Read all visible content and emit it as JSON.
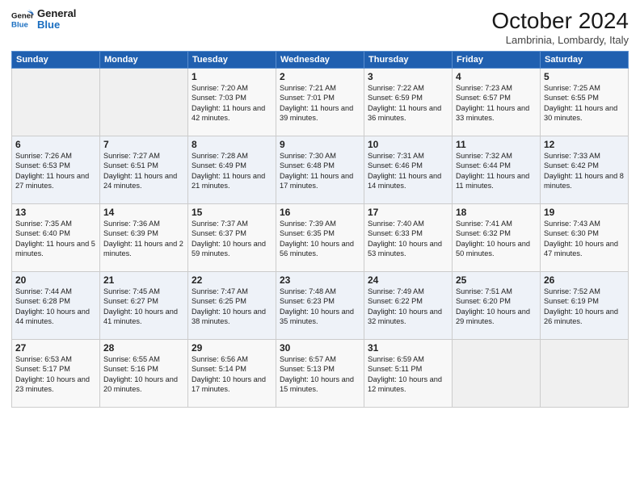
{
  "logo": {
    "line1": "General",
    "line2": "Blue"
  },
  "title": "October 2024",
  "subtitle": "Lambrinia, Lombardy, Italy",
  "days_header": [
    "Sunday",
    "Monday",
    "Tuesday",
    "Wednesday",
    "Thursday",
    "Friday",
    "Saturday"
  ],
  "weeks": [
    [
      {
        "day": "",
        "text": ""
      },
      {
        "day": "",
        "text": ""
      },
      {
        "day": "1",
        "text": "Sunrise: 7:20 AM\nSunset: 7:03 PM\nDaylight: 11 hours and 42 minutes."
      },
      {
        "day": "2",
        "text": "Sunrise: 7:21 AM\nSunset: 7:01 PM\nDaylight: 11 hours and 39 minutes."
      },
      {
        "day": "3",
        "text": "Sunrise: 7:22 AM\nSunset: 6:59 PM\nDaylight: 11 hours and 36 minutes."
      },
      {
        "day": "4",
        "text": "Sunrise: 7:23 AM\nSunset: 6:57 PM\nDaylight: 11 hours and 33 minutes."
      },
      {
        "day": "5",
        "text": "Sunrise: 7:25 AM\nSunset: 6:55 PM\nDaylight: 11 hours and 30 minutes."
      }
    ],
    [
      {
        "day": "6",
        "text": "Sunrise: 7:26 AM\nSunset: 6:53 PM\nDaylight: 11 hours and 27 minutes."
      },
      {
        "day": "7",
        "text": "Sunrise: 7:27 AM\nSunset: 6:51 PM\nDaylight: 11 hours and 24 minutes."
      },
      {
        "day": "8",
        "text": "Sunrise: 7:28 AM\nSunset: 6:49 PM\nDaylight: 11 hours and 21 minutes."
      },
      {
        "day": "9",
        "text": "Sunrise: 7:30 AM\nSunset: 6:48 PM\nDaylight: 11 hours and 17 minutes."
      },
      {
        "day": "10",
        "text": "Sunrise: 7:31 AM\nSunset: 6:46 PM\nDaylight: 11 hours and 14 minutes."
      },
      {
        "day": "11",
        "text": "Sunrise: 7:32 AM\nSunset: 6:44 PM\nDaylight: 11 hours and 11 minutes."
      },
      {
        "day": "12",
        "text": "Sunrise: 7:33 AM\nSunset: 6:42 PM\nDaylight: 11 hours and 8 minutes."
      }
    ],
    [
      {
        "day": "13",
        "text": "Sunrise: 7:35 AM\nSunset: 6:40 PM\nDaylight: 11 hours and 5 minutes."
      },
      {
        "day": "14",
        "text": "Sunrise: 7:36 AM\nSunset: 6:39 PM\nDaylight: 11 hours and 2 minutes."
      },
      {
        "day": "15",
        "text": "Sunrise: 7:37 AM\nSunset: 6:37 PM\nDaylight: 10 hours and 59 minutes."
      },
      {
        "day": "16",
        "text": "Sunrise: 7:39 AM\nSunset: 6:35 PM\nDaylight: 10 hours and 56 minutes."
      },
      {
        "day": "17",
        "text": "Sunrise: 7:40 AM\nSunset: 6:33 PM\nDaylight: 10 hours and 53 minutes."
      },
      {
        "day": "18",
        "text": "Sunrise: 7:41 AM\nSunset: 6:32 PM\nDaylight: 10 hours and 50 minutes."
      },
      {
        "day": "19",
        "text": "Sunrise: 7:43 AM\nSunset: 6:30 PM\nDaylight: 10 hours and 47 minutes."
      }
    ],
    [
      {
        "day": "20",
        "text": "Sunrise: 7:44 AM\nSunset: 6:28 PM\nDaylight: 10 hours and 44 minutes."
      },
      {
        "day": "21",
        "text": "Sunrise: 7:45 AM\nSunset: 6:27 PM\nDaylight: 10 hours and 41 minutes."
      },
      {
        "day": "22",
        "text": "Sunrise: 7:47 AM\nSunset: 6:25 PM\nDaylight: 10 hours and 38 minutes."
      },
      {
        "day": "23",
        "text": "Sunrise: 7:48 AM\nSunset: 6:23 PM\nDaylight: 10 hours and 35 minutes."
      },
      {
        "day": "24",
        "text": "Sunrise: 7:49 AM\nSunset: 6:22 PM\nDaylight: 10 hours and 32 minutes."
      },
      {
        "day": "25",
        "text": "Sunrise: 7:51 AM\nSunset: 6:20 PM\nDaylight: 10 hours and 29 minutes."
      },
      {
        "day": "26",
        "text": "Sunrise: 7:52 AM\nSunset: 6:19 PM\nDaylight: 10 hours and 26 minutes."
      }
    ],
    [
      {
        "day": "27",
        "text": "Sunrise: 6:53 AM\nSunset: 5:17 PM\nDaylight: 10 hours and 23 minutes."
      },
      {
        "day": "28",
        "text": "Sunrise: 6:55 AM\nSunset: 5:16 PM\nDaylight: 10 hours and 20 minutes."
      },
      {
        "day": "29",
        "text": "Sunrise: 6:56 AM\nSunset: 5:14 PM\nDaylight: 10 hours and 17 minutes."
      },
      {
        "day": "30",
        "text": "Sunrise: 6:57 AM\nSunset: 5:13 PM\nDaylight: 10 hours and 15 minutes."
      },
      {
        "day": "31",
        "text": "Sunrise: 6:59 AM\nSunset: 5:11 PM\nDaylight: 10 hours and 12 minutes."
      },
      {
        "day": "",
        "text": ""
      },
      {
        "day": "",
        "text": ""
      }
    ]
  ]
}
